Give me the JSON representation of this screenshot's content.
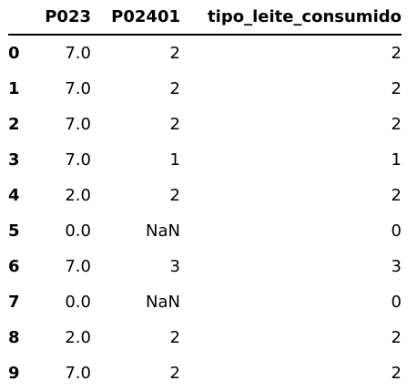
{
  "table": {
    "columns": {
      "index": "",
      "p023": "P023",
      "p02401": "P02401",
      "tipo": "tipo_leite_consumido"
    },
    "rows": [
      {
        "index": "0",
        "p023": "7.0",
        "p02401": "2",
        "tipo": "2"
      },
      {
        "index": "1",
        "p023": "7.0",
        "p02401": "2",
        "tipo": "2"
      },
      {
        "index": "2",
        "p023": "7.0",
        "p02401": "2",
        "tipo": "2"
      },
      {
        "index": "3",
        "p023": "7.0",
        "p02401": "1",
        "tipo": "1"
      },
      {
        "index": "4",
        "p023": "2.0",
        "p02401": "2",
        "tipo": "2"
      },
      {
        "index": "5",
        "p023": "0.0",
        "p02401": "NaN",
        "tipo": "0"
      },
      {
        "index": "6",
        "p023": "7.0",
        "p02401": "3",
        "tipo": "3"
      },
      {
        "index": "7",
        "p023": "0.0",
        "p02401": "NaN",
        "tipo": "0"
      },
      {
        "index": "8",
        "p023": "2.0",
        "p02401": "2",
        "tipo": "2"
      },
      {
        "index": "9",
        "p023": "7.0",
        "p02401": "2",
        "tipo": "2"
      }
    ]
  }
}
